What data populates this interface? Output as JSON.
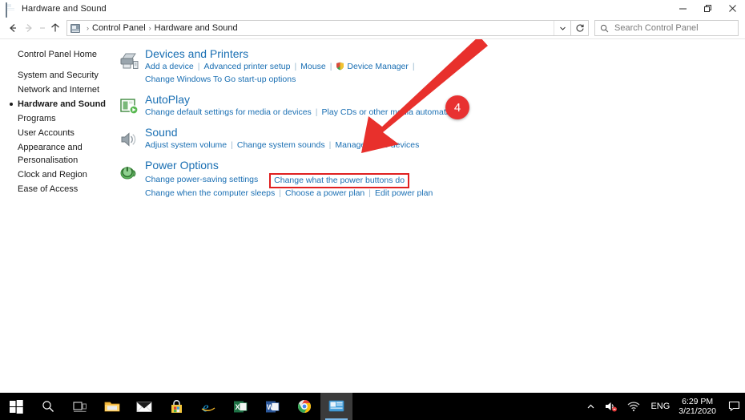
{
  "window": {
    "title": "Hardware and Sound",
    "title_icon": "control-panel-icon",
    "controls": {
      "minimize": "Minimize",
      "restore": "Restore",
      "close": "Close"
    }
  },
  "navigation": {
    "back": "Back",
    "forward": "Forward",
    "recent": "Recent locations",
    "up": "Up one level",
    "refresh": "Refresh",
    "dropdown": "Previous locations",
    "breadcrumb": [
      "Control Panel",
      "Hardware and Sound"
    ],
    "separator": "›"
  },
  "search": {
    "placeholder": "Search Control Panel",
    "value": "",
    "icon": "search-icon"
  },
  "sidebar": {
    "home": "Control Panel Home",
    "items": [
      {
        "label": "System and Security",
        "current": false
      },
      {
        "label": "Network and Internet",
        "current": false
      },
      {
        "label": "Hardware and Sound",
        "current": true
      },
      {
        "label": "Programs",
        "current": false
      },
      {
        "label": "User Accounts",
        "current": false
      },
      {
        "label": "Appearance and Personalisation",
        "current": false
      },
      {
        "label": "Clock and Region",
        "current": false
      },
      {
        "label": "Ease of Access",
        "current": false
      }
    ]
  },
  "categories": [
    {
      "title": "Devices and Printers",
      "icon": "printer-icon",
      "rows": [
        [
          {
            "label": "Add a device"
          },
          {
            "label": "Advanced printer setup"
          },
          {
            "label": "Mouse"
          },
          {
            "label": "Device Manager",
            "shield": true
          }
        ],
        [
          {
            "label": "Change Windows To Go start-up options"
          }
        ]
      ]
    },
    {
      "title": "AutoPlay",
      "icon": "autoplay-icon",
      "rows": [
        [
          {
            "label": "Change default settings for media or devices"
          },
          {
            "label": "Play CDs or other media automatically"
          }
        ]
      ]
    },
    {
      "title": "Sound",
      "icon": "sound-icon",
      "rows": [
        [
          {
            "label": "Adjust system volume"
          },
          {
            "label": "Change system sounds"
          },
          {
            "label": "Manage audio devices"
          }
        ]
      ]
    },
    {
      "title": "Power Options",
      "icon": "power-options-icon",
      "rows": [
        [
          {
            "label": "Change power-saving settings"
          },
          {
            "label": "Change what the power buttons do",
            "highlighted": true
          }
        ],
        [
          {
            "label": "Change when the computer sleeps"
          },
          {
            "label": "Choose a power plan"
          },
          {
            "label": "Edit power plan"
          }
        ]
      ]
    }
  ],
  "annotation": {
    "badge": "4",
    "arrow": "red-arrow",
    "highlight_color": "#e02020",
    "badge_color": "#e83131"
  },
  "taskbar": {
    "items": [
      {
        "name": "start-button",
        "label": "Start"
      },
      {
        "name": "search-button",
        "label": "Search"
      },
      {
        "name": "task-view-button",
        "label": "Task View"
      },
      {
        "name": "file-explorer-button",
        "label": "File Explorer"
      },
      {
        "name": "mail-button",
        "label": "Mail"
      },
      {
        "name": "microsoft-store-button",
        "label": "Microsoft Store"
      },
      {
        "name": "internet-explorer-button",
        "label": "Internet Explorer"
      },
      {
        "name": "excel-button",
        "label": "Excel"
      },
      {
        "name": "word-button",
        "label": "Word"
      },
      {
        "name": "chrome-button",
        "label": "Google Chrome"
      },
      {
        "name": "control-panel-button",
        "label": "Control Panel",
        "active": true
      }
    ],
    "tray": {
      "show_hidden": "Show hidden icons",
      "volume": "Volume muted",
      "network": "Network",
      "language": "ENG",
      "time": "6:29 PM",
      "date": "3/21/2020",
      "action_center": "Notifications"
    }
  }
}
